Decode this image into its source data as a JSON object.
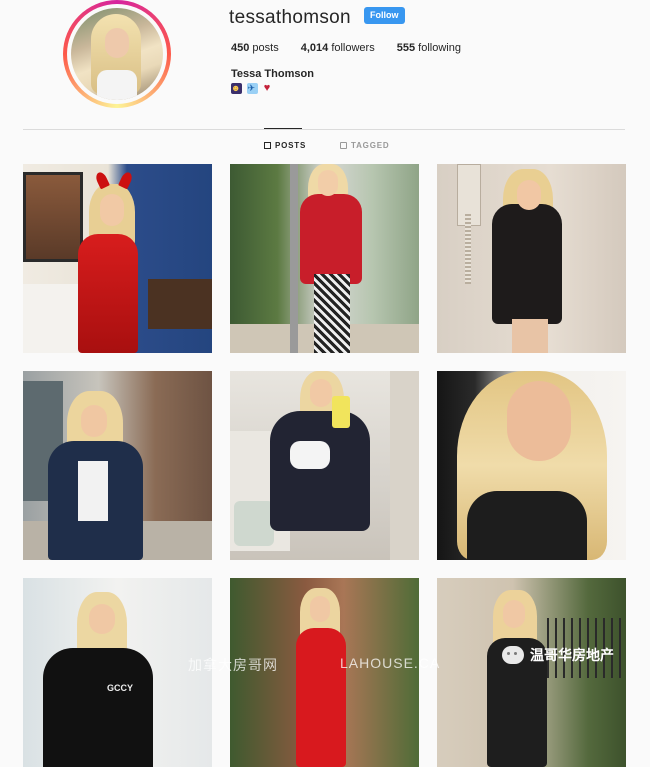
{
  "profile": {
    "username": "tessathomson",
    "follow_label": "Follow",
    "posts_count": "450",
    "posts_label": "posts",
    "followers_count": "4,014",
    "followers_label": "followers",
    "following_count": "555",
    "following_label": "following",
    "full_name": "Tessa Thomson",
    "bio_emojis": [
      "nerd-face-emoji",
      "airplane-emoji",
      "heart-emoji"
    ]
  },
  "tabs": [
    {
      "label": "POSTS",
      "active": true,
      "icon": "grid-icon"
    },
    {
      "label": "TAGGED",
      "active": false,
      "icon": "tag-icon"
    }
  ],
  "watermarks": {
    "left": "加拿大房哥网",
    "middle": "LAHOUSE.CA",
    "right": "温哥华房地产"
  },
  "colors": {
    "follow_button": "#3897f0",
    "background": "#fafafa",
    "text": "#262626"
  }
}
